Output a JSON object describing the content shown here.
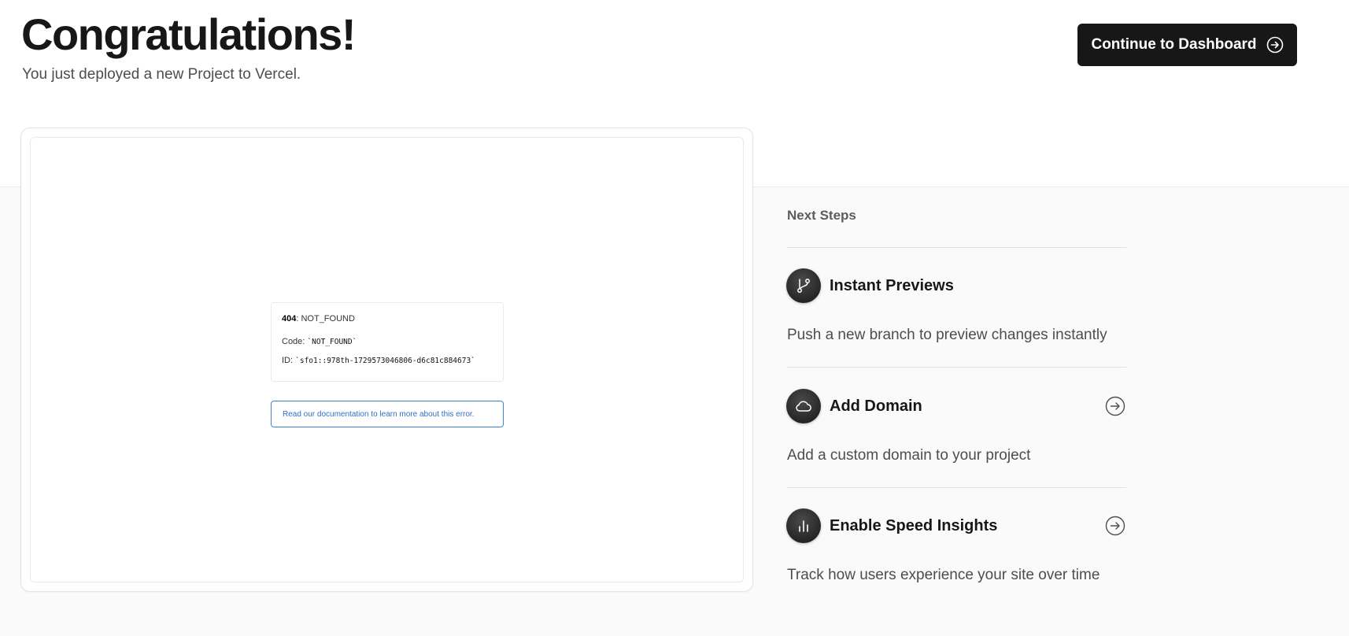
{
  "header": {
    "title": "Congratulations!",
    "subtitle": "You just deployed a new Project to Vercel.",
    "continue_button_label": "Continue to Dashboard"
  },
  "preview": {
    "error": {
      "status_code": "404",
      "status_text": ": NOT_FOUND",
      "code_label": "Code: ",
      "code_value": "`NOT_FOUND`",
      "id_label": "ID: ",
      "id_value": "`sfo1::978th-1729573046806-d6c81c884673`"
    },
    "doc_link_text": "Read our documentation to learn more about this error."
  },
  "next_steps": {
    "heading": "Next Steps",
    "items": [
      {
        "title": "Instant Previews",
        "description": "Push a new branch to preview changes instantly",
        "icon": "git-branch-icon",
        "has_arrow": false
      },
      {
        "title": "Add Domain",
        "description": "Add a custom domain to your project",
        "icon": "cloud-icon",
        "has_arrow": true
      },
      {
        "title": "Enable Speed Insights",
        "description": "Track how users experience your site over time",
        "icon": "bar-chart-icon",
        "has_arrow": true
      }
    ]
  },
  "colors": {
    "primary_button": "#171717",
    "background_band": "#fafafa",
    "link_blue": "#2f6fc9"
  }
}
